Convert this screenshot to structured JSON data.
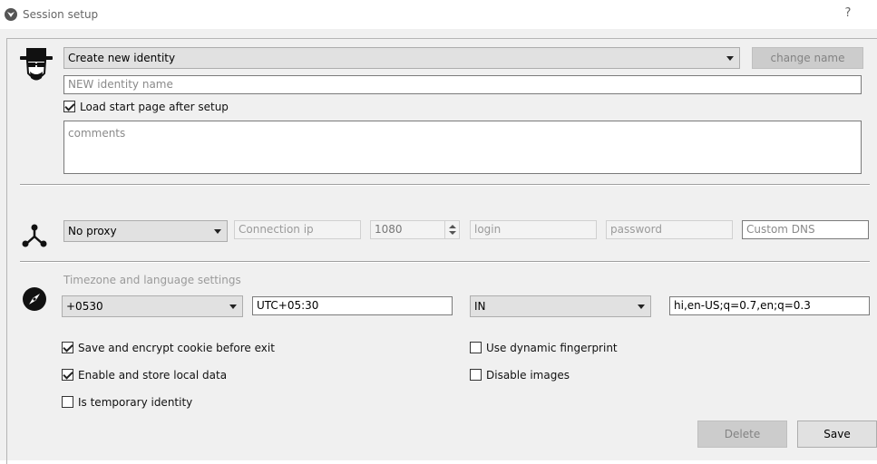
{
  "window": {
    "title": "Session setup",
    "help": "?"
  },
  "identity": {
    "selected": "Create new identity",
    "change_name_label": "change name",
    "name_placeholder": "NEW identity name",
    "load_start_page_label": "Load start page after setup",
    "load_start_page_checked": true,
    "comments_placeholder": "comments"
  },
  "proxy": {
    "selected": "No proxy",
    "connection_ip_placeholder": "Connection ip",
    "port_value": "1080",
    "login_placeholder": "login",
    "password_placeholder": "password",
    "custom_dns_placeholder": "Custom DNS"
  },
  "timezone": {
    "section_title": "Timezone and language settings",
    "offset_selected": "+0530",
    "tz_value": "UTC+05:30",
    "country_selected": "IN",
    "language_value": "hi,en-US;q=0.7,en;q=0.3"
  },
  "options": {
    "save_cookie_label": "Save and encrypt cookie before exit",
    "save_cookie_checked": true,
    "local_data_label": "Enable and store local data",
    "local_data_checked": true,
    "temporary_label": "Is temporary identity",
    "temporary_checked": false,
    "dynamic_fp_label": "Use dynamic fingerprint",
    "dynamic_fp_checked": false,
    "disable_images_label": "Disable images",
    "disable_images_checked": false
  },
  "actions": {
    "delete_label": "Delete",
    "save_label": "Save"
  }
}
